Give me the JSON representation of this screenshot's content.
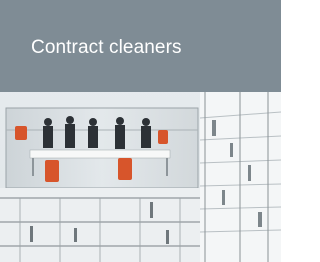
{
  "card": {
    "title": "Contract cleaners",
    "header_color": "#7f8c95",
    "title_color": "#ffffff",
    "image": {
      "description_icon": "office-atrium-meeting-photo"
    }
  }
}
